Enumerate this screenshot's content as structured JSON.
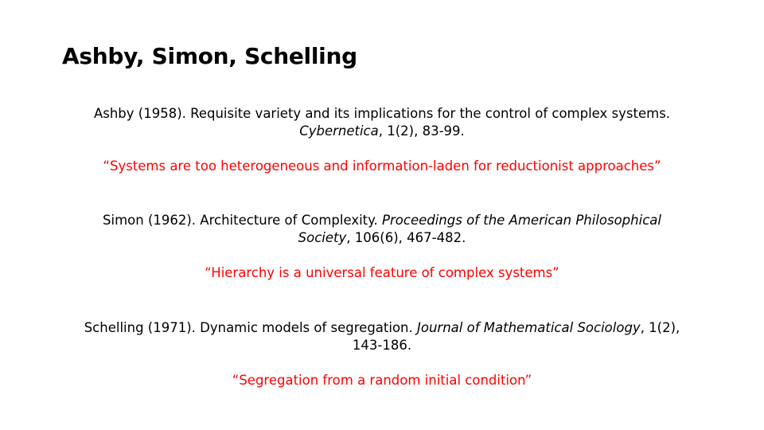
{
  "slide": {
    "title": "Ashby, Simon, Schelling",
    "references": [
      {
        "pre": "Ashby (1958). Requisite variety and its implications for the control of complex systems.",
        "journal": "Cybernetica",
        "post": ", 1(2), 83-99.",
        "quote": "“Systems are too heterogeneous and information-laden for reductionist approaches”"
      },
      {
        "pre": "Simon (1962). Architecture of Complexity.",
        "journal": "Proceedings of the American Philosophical Society",
        "post": ", 106(6), 467-482.",
        "quote": "“Hierarchy is a universal feature of complex systems”"
      },
      {
        "pre": "Schelling (1971). Dynamic models of segregation.",
        "journal": "Journal of Mathematical Sociology",
        "post": ", 1(2), 143-186.",
        "quote": "“Segregation from a random initial condition”"
      }
    ],
    "colors": {
      "text": "#000000",
      "quote": "#ff0000",
      "background": "#ffffff"
    }
  }
}
